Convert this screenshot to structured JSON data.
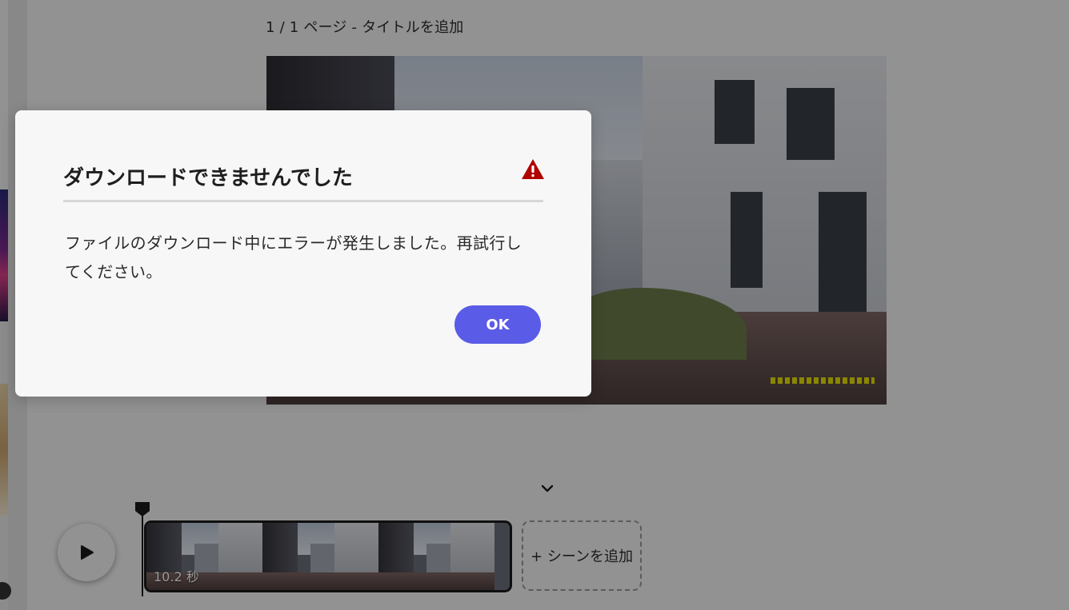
{
  "editor": {
    "page_title": "1 / 1 ページ - タイトルを追加"
  },
  "timeline": {
    "clip_duration": "10.2 秒",
    "add_scene_label": "+ シーンを追加",
    "collapse_icon": "chevron-down-icon",
    "play_icon": "play-icon"
  },
  "dialog": {
    "title": "ダウンロードできませんでした",
    "message": "ファイルのダウンロード中にエラーが発生しました。再試行してください。",
    "ok_label": "OK",
    "icon": "warning-icon",
    "icon_color": "#b00000"
  },
  "colors": {
    "primary_button": "#5a5be6",
    "overlay": "rgba(0,0,0,0.4)"
  }
}
